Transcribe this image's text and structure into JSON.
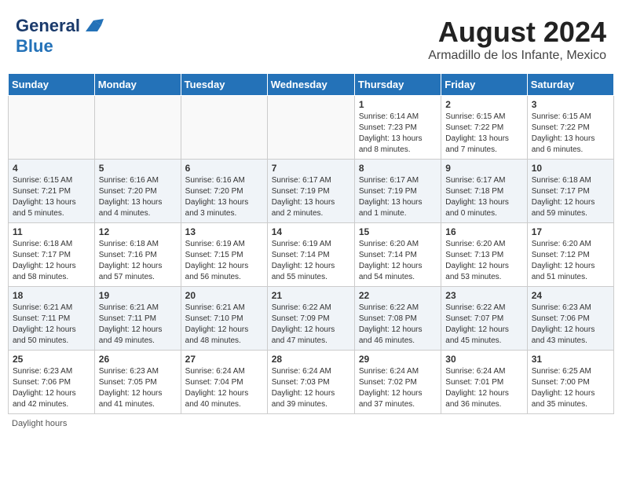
{
  "header": {
    "logo_general": "General",
    "logo_blue": "Blue",
    "month_title": "August 2024",
    "subtitle": "Armadillo de los Infante, Mexico"
  },
  "footer": {
    "daylight_hours": "Daylight hours"
  },
  "days_of_week": [
    "Sunday",
    "Monday",
    "Tuesday",
    "Wednesday",
    "Thursday",
    "Friday",
    "Saturday"
  ],
  "weeks": [
    {
      "days": [
        {
          "number": "",
          "info": ""
        },
        {
          "number": "",
          "info": ""
        },
        {
          "number": "",
          "info": ""
        },
        {
          "number": "",
          "info": ""
        },
        {
          "number": "1",
          "info": "Sunrise: 6:14 AM\nSunset: 7:23 PM\nDaylight: 13 hours\nand 8 minutes."
        },
        {
          "number": "2",
          "info": "Sunrise: 6:15 AM\nSunset: 7:22 PM\nDaylight: 13 hours\nand 7 minutes."
        },
        {
          "number": "3",
          "info": "Sunrise: 6:15 AM\nSunset: 7:22 PM\nDaylight: 13 hours\nand 6 minutes."
        }
      ]
    },
    {
      "days": [
        {
          "number": "4",
          "info": "Sunrise: 6:15 AM\nSunset: 7:21 PM\nDaylight: 13 hours\nand 5 minutes."
        },
        {
          "number": "5",
          "info": "Sunrise: 6:16 AM\nSunset: 7:20 PM\nDaylight: 13 hours\nand 4 minutes."
        },
        {
          "number": "6",
          "info": "Sunrise: 6:16 AM\nSunset: 7:20 PM\nDaylight: 13 hours\nand 3 minutes."
        },
        {
          "number": "7",
          "info": "Sunrise: 6:17 AM\nSunset: 7:19 PM\nDaylight: 13 hours\nand 2 minutes."
        },
        {
          "number": "8",
          "info": "Sunrise: 6:17 AM\nSunset: 7:19 PM\nDaylight: 13 hours\nand 1 minute."
        },
        {
          "number": "9",
          "info": "Sunrise: 6:17 AM\nSunset: 7:18 PM\nDaylight: 13 hours\nand 0 minutes."
        },
        {
          "number": "10",
          "info": "Sunrise: 6:18 AM\nSunset: 7:17 PM\nDaylight: 12 hours\nand 59 minutes."
        }
      ]
    },
    {
      "days": [
        {
          "number": "11",
          "info": "Sunrise: 6:18 AM\nSunset: 7:17 PM\nDaylight: 12 hours\nand 58 minutes."
        },
        {
          "number": "12",
          "info": "Sunrise: 6:18 AM\nSunset: 7:16 PM\nDaylight: 12 hours\nand 57 minutes."
        },
        {
          "number": "13",
          "info": "Sunrise: 6:19 AM\nSunset: 7:15 PM\nDaylight: 12 hours\nand 56 minutes."
        },
        {
          "number": "14",
          "info": "Sunrise: 6:19 AM\nSunset: 7:14 PM\nDaylight: 12 hours\nand 55 minutes."
        },
        {
          "number": "15",
          "info": "Sunrise: 6:20 AM\nSunset: 7:14 PM\nDaylight: 12 hours\nand 54 minutes."
        },
        {
          "number": "16",
          "info": "Sunrise: 6:20 AM\nSunset: 7:13 PM\nDaylight: 12 hours\nand 53 minutes."
        },
        {
          "number": "17",
          "info": "Sunrise: 6:20 AM\nSunset: 7:12 PM\nDaylight: 12 hours\nand 51 minutes."
        }
      ]
    },
    {
      "days": [
        {
          "number": "18",
          "info": "Sunrise: 6:21 AM\nSunset: 7:11 PM\nDaylight: 12 hours\nand 50 minutes."
        },
        {
          "number": "19",
          "info": "Sunrise: 6:21 AM\nSunset: 7:11 PM\nDaylight: 12 hours\nand 49 minutes."
        },
        {
          "number": "20",
          "info": "Sunrise: 6:21 AM\nSunset: 7:10 PM\nDaylight: 12 hours\nand 48 minutes."
        },
        {
          "number": "21",
          "info": "Sunrise: 6:22 AM\nSunset: 7:09 PM\nDaylight: 12 hours\nand 47 minutes."
        },
        {
          "number": "22",
          "info": "Sunrise: 6:22 AM\nSunset: 7:08 PM\nDaylight: 12 hours\nand 46 minutes."
        },
        {
          "number": "23",
          "info": "Sunrise: 6:22 AM\nSunset: 7:07 PM\nDaylight: 12 hours\nand 45 minutes."
        },
        {
          "number": "24",
          "info": "Sunrise: 6:23 AM\nSunset: 7:06 PM\nDaylight: 12 hours\nand 43 minutes."
        }
      ]
    },
    {
      "days": [
        {
          "number": "25",
          "info": "Sunrise: 6:23 AM\nSunset: 7:06 PM\nDaylight: 12 hours\nand 42 minutes."
        },
        {
          "number": "26",
          "info": "Sunrise: 6:23 AM\nSunset: 7:05 PM\nDaylight: 12 hours\nand 41 minutes."
        },
        {
          "number": "27",
          "info": "Sunrise: 6:24 AM\nSunset: 7:04 PM\nDaylight: 12 hours\nand 40 minutes."
        },
        {
          "number": "28",
          "info": "Sunrise: 6:24 AM\nSunset: 7:03 PM\nDaylight: 12 hours\nand 39 minutes."
        },
        {
          "number": "29",
          "info": "Sunrise: 6:24 AM\nSunset: 7:02 PM\nDaylight: 12 hours\nand 37 minutes."
        },
        {
          "number": "30",
          "info": "Sunrise: 6:24 AM\nSunset: 7:01 PM\nDaylight: 12 hours\nand 36 minutes."
        },
        {
          "number": "31",
          "info": "Sunrise: 6:25 AM\nSunset: 7:00 PM\nDaylight: 12 hours\nand 35 minutes."
        }
      ]
    }
  ]
}
